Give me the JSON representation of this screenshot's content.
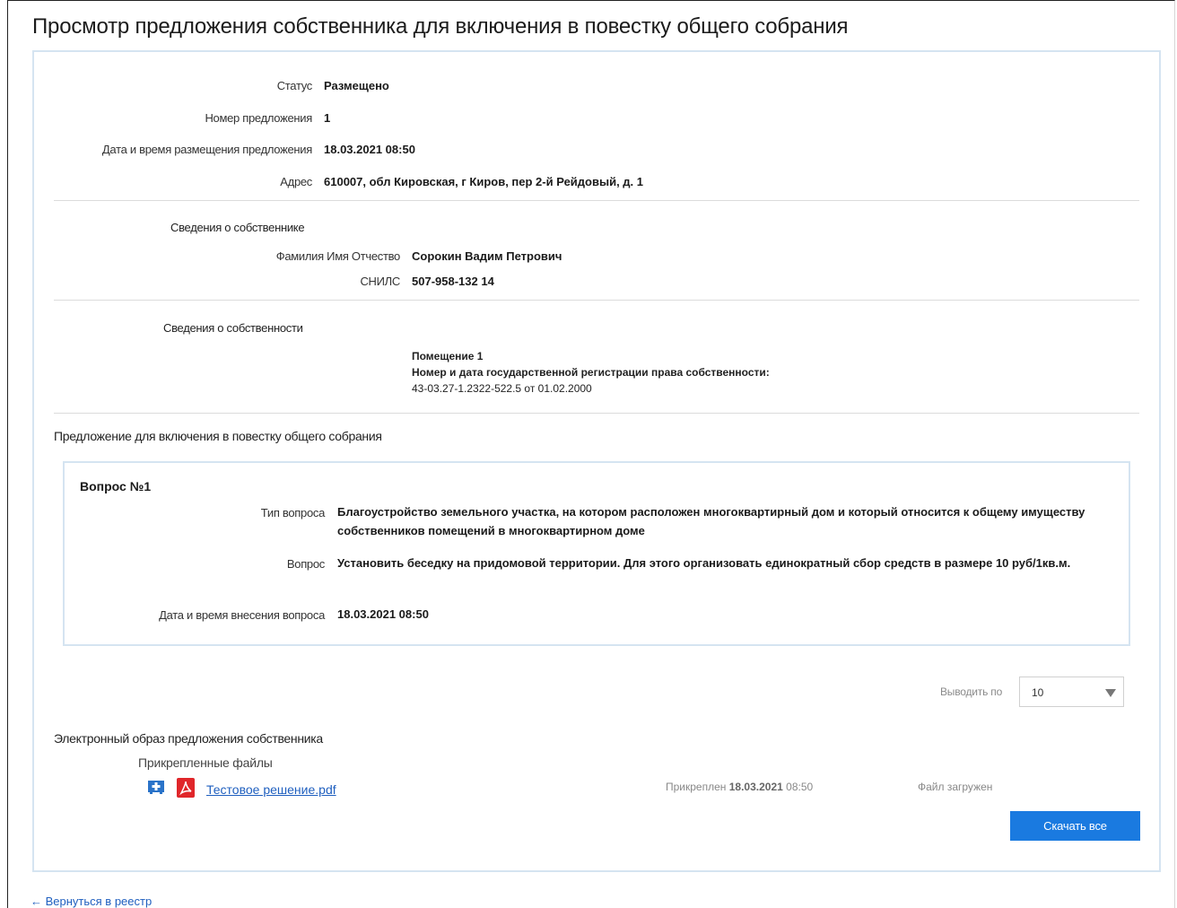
{
  "page_title": "Просмотр предложения собственника для включения в повестку общего собрания",
  "summary": {
    "status_label": "Статус",
    "status_value": "Размещено",
    "number_label": "Номер предложения",
    "number_value": "1",
    "date_label": "Дата и время размещения предложения",
    "date_value": "18.03.2021 08:50",
    "address_label": "Адрес",
    "address_value": "610007, обл Кировская, г Киров, пер 2-й Рейдовый, д. 1"
  },
  "owner": {
    "section_label": "Сведения о собственнике",
    "fio_label": "Фамилия Имя Отчество",
    "fio_value": "Сорокин Вадим Петрович",
    "snils_label": "СНИЛС",
    "snils_value": "507-958-132 14"
  },
  "property": {
    "section_label": "Сведения о собственности",
    "room": "Помещение 1",
    "reg_label": "Номер и дата государственной регистрации права собственности:",
    "reg_value": "43-03.27-1.2322-522.5 от 01.02.2000"
  },
  "proposal": {
    "section_label": "Предложение для включения в повестку общего собрания",
    "question_title": "Вопрос №1",
    "type_label": "Тип вопроса",
    "type_value": "Благоустройство земельного участка, на котором расположен многоквартирный дом и который относится к общему имуществу собственников помещений в многоквартирном доме",
    "question_label": "Вопрос",
    "question_value": "Установить беседку на придомовой территории. Для этого организовать единократный сбор средств в размере 10 руб/1кв.м.",
    "date_label": "Дата и время внесения вопроса",
    "date_value": "18.03.2021 08:50"
  },
  "pager": {
    "label": "Выводить по",
    "value": "10"
  },
  "electronic": {
    "section_label": "Электронный образ предложения собственника",
    "attached_label": "Прикрепленные файлы",
    "file_name": "Тестовое решение.pdf",
    "attached_prefix": "Прикреплен",
    "attached_date": "18.03.2021",
    "attached_time": "08:50",
    "file_status": "Файл загружен",
    "download_all": "Скачать все"
  },
  "back_link": "← Вернуться в реестр",
  "colors": {
    "accent": "#1a7ae0",
    "link": "#1f5fbf",
    "card_border": "#d5e4f1",
    "pdf_red": "#e0262a"
  }
}
